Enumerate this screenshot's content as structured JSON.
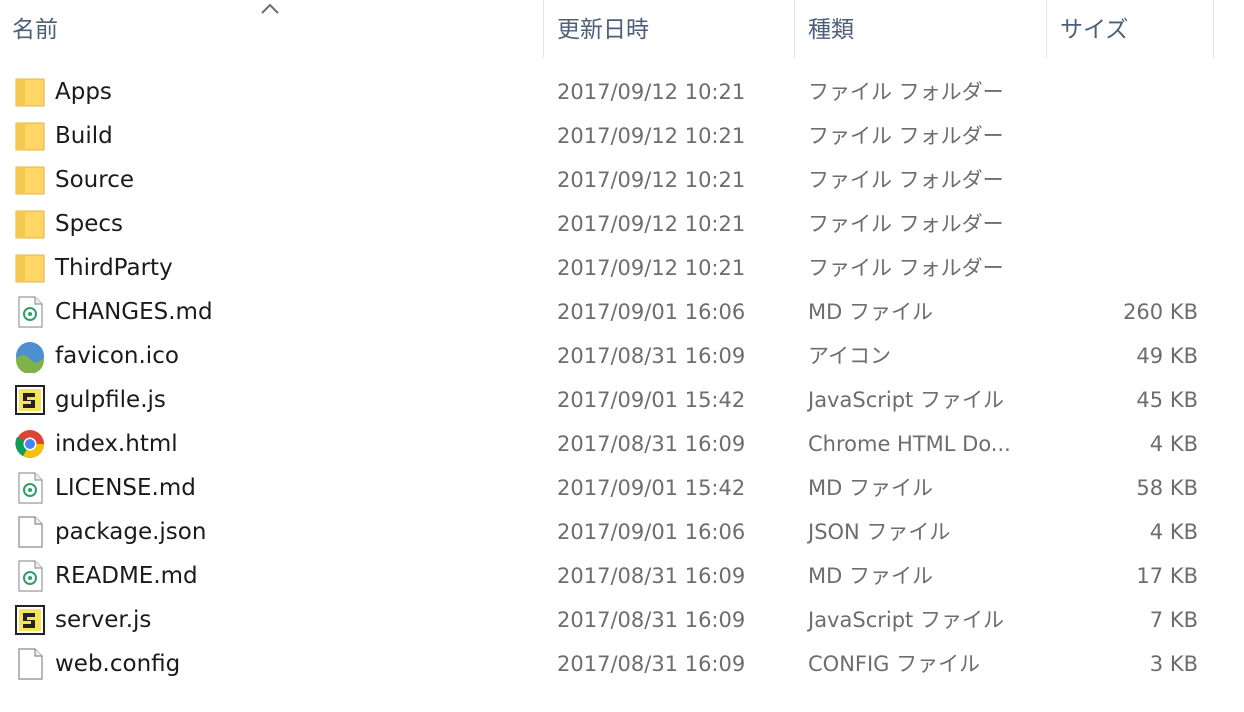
{
  "columns": {
    "name": "名前",
    "modified": "更新日時",
    "type": "種類",
    "size": "サイズ"
  },
  "files": [
    {
      "name": "Apps",
      "modified": "2017/09/12 10:21",
      "type": "ファイル フォルダー",
      "size": "",
      "icon": "folder-icon"
    },
    {
      "name": "Build",
      "modified": "2017/09/12 10:21",
      "type": "ファイル フォルダー",
      "size": "",
      "icon": "folder-icon"
    },
    {
      "name": "Source",
      "modified": "2017/09/12 10:21",
      "type": "ファイル フォルダー",
      "size": "",
      "icon": "folder-icon"
    },
    {
      "name": "Specs",
      "modified": "2017/09/12 10:21",
      "type": "ファイル フォルダー",
      "size": "",
      "icon": "folder-icon"
    },
    {
      "name": "ThirdParty",
      "modified": "2017/09/12 10:21",
      "type": "ファイル フォルダー",
      "size": "",
      "icon": "folder-icon"
    },
    {
      "name": "CHANGES.md",
      "modified": "2017/09/01 16:06",
      "type": "MD ファイル",
      "size": "260 KB",
      "icon": "markdown-file-icon"
    },
    {
      "name": "favicon.ico",
      "modified": "2017/08/31 16:09",
      "type": "アイコン",
      "size": "49 KB",
      "icon": "image-icon"
    },
    {
      "name": "gulpfile.js",
      "modified": "2017/09/01 15:42",
      "type": "JavaScript ファイル",
      "size": "45 KB",
      "icon": "script-file-icon"
    },
    {
      "name": "index.html",
      "modified": "2017/08/31 16:09",
      "type": "Chrome HTML Do...",
      "size": "4 KB",
      "icon": "chrome-icon"
    },
    {
      "name": "LICENSE.md",
      "modified": "2017/09/01 15:42",
      "type": "MD ファイル",
      "size": "58 KB",
      "icon": "markdown-file-icon"
    },
    {
      "name": "package.json",
      "modified": "2017/09/01 16:06",
      "type": "JSON ファイル",
      "size": "4 KB",
      "icon": "blank-file-icon"
    },
    {
      "name": "README.md",
      "modified": "2017/08/31 16:09",
      "type": "MD ファイル",
      "size": "17 KB",
      "icon": "markdown-file-icon"
    },
    {
      "name": "server.js",
      "modified": "2017/08/31 16:09",
      "type": "JavaScript ファイル",
      "size": "7 KB",
      "icon": "script-file-icon"
    },
    {
      "name": "web.config",
      "modified": "2017/08/31 16:09",
      "type": "CONFIG ファイル",
      "size": "3 KB",
      "icon": "blank-file-icon"
    }
  ]
}
